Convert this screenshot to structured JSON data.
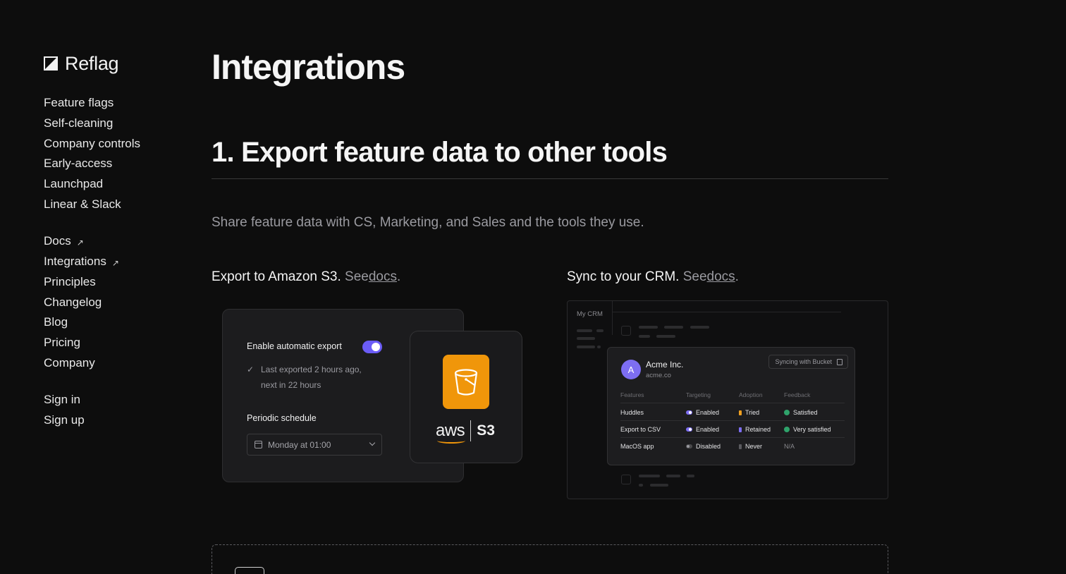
{
  "brand": {
    "name": "Reflag"
  },
  "sidebar": {
    "primary": [
      {
        "label": "Feature flags"
      },
      {
        "label": "Self-cleaning"
      },
      {
        "label": "Company controls"
      },
      {
        "label": "Early-access"
      },
      {
        "label": "Launchpad"
      },
      {
        "label": "Linear & Slack"
      }
    ],
    "secondary": [
      {
        "label": "Docs",
        "external": true
      },
      {
        "label": "Integrations",
        "external": true
      },
      {
        "label": "Principles"
      },
      {
        "label": "Changelog"
      },
      {
        "label": "Blog"
      },
      {
        "label": "Pricing"
      },
      {
        "label": "Company"
      }
    ],
    "auth": [
      {
        "label": "Sign in"
      },
      {
        "label": "Sign up"
      }
    ],
    "external_icon": "↗"
  },
  "main": {
    "title": "Integrations",
    "section_title": "1. Export feature data to other tools",
    "lead": "Share feature data with CS, Marketing, and Sales and the tools they use.",
    "s3_heading": {
      "text": "Export to Amazon S3.",
      "see": "See",
      "link": "docs",
      "end": "."
    },
    "crm_heading": {
      "text": "Sync to your CRM.",
      "see": "See",
      "link": "docs",
      "end": "."
    }
  },
  "s3_card": {
    "toggle_label": "Enable automatic export",
    "toggle_on": true,
    "status_line1": "Last exported 2 hours ago,",
    "status_line2": "next in 22 hours",
    "schedule_label": "Periodic schedule",
    "schedule_value": "Monday at 01:00",
    "aws_text": "aws",
    "s3_text": "S3",
    "accent": "#f0960a",
    "toggle_color": "#6b5cf6"
  },
  "crm_card": {
    "title": "My CRM",
    "company": {
      "initial": "A",
      "name": "Acme Inc.",
      "domain": "acme.co"
    },
    "sync_label": "Syncing with Bucket",
    "columns": [
      "Features",
      "Targeting",
      "Adoption",
      "Feedback"
    ],
    "rows": [
      {
        "feature": "Huddles",
        "targeting": "Enabled",
        "targeting_on": true,
        "adoption": "Tried",
        "adoption_color": "#f0a020",
        "feedback": "Satisfied",
        "feedback_color": "#2fa36b"
      },
      {
        "feature": "Export to CSV",
        "targeting": "Enabled",
        "targeting_on": true,
        "adoption": "Retained",
        "adoption_color": "#7d6ef2",
        "feedback": "Very satisfied",
        "feedback_color": "#2fa36b"
      },
      {
        "feature": "MacOS app",
        "targeting": "Disabled",
        "targeting_on": false,
        "adoption": "Never",
        "adoption_color": "#5a5a5e",
        "feedback": "N/A",
        "feedback_color": ""
      }
    ]
  }
}
